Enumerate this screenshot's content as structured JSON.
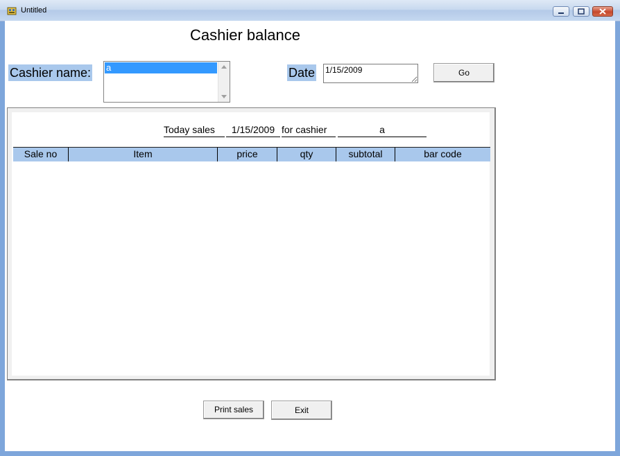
{
  "window": {
    "title": "Untitled"
  },
  "form": {
    "heading": "Cashier balance",
    "cashier_label": "Cashier name:",
    "cashier_items": [
      "a"
    ],
    "date_label": "Date",
    "date_value": "1/15/2009",
    "go_label": "Go"
  },
  "report": {
    "today_sales_label": "Today sales",
    "date": "1/15/2009",
    "for_cashier_label": "for cashier",
    "cashier": "a",
    "columns": [
      "Sale no",
      "Item",
      "price",
      "qty",
      "subtotal",
      "bar code"
    ]
  },
  "buttons": {
    "print": "Print sales",
    "exit": "Exit"
  }
}
